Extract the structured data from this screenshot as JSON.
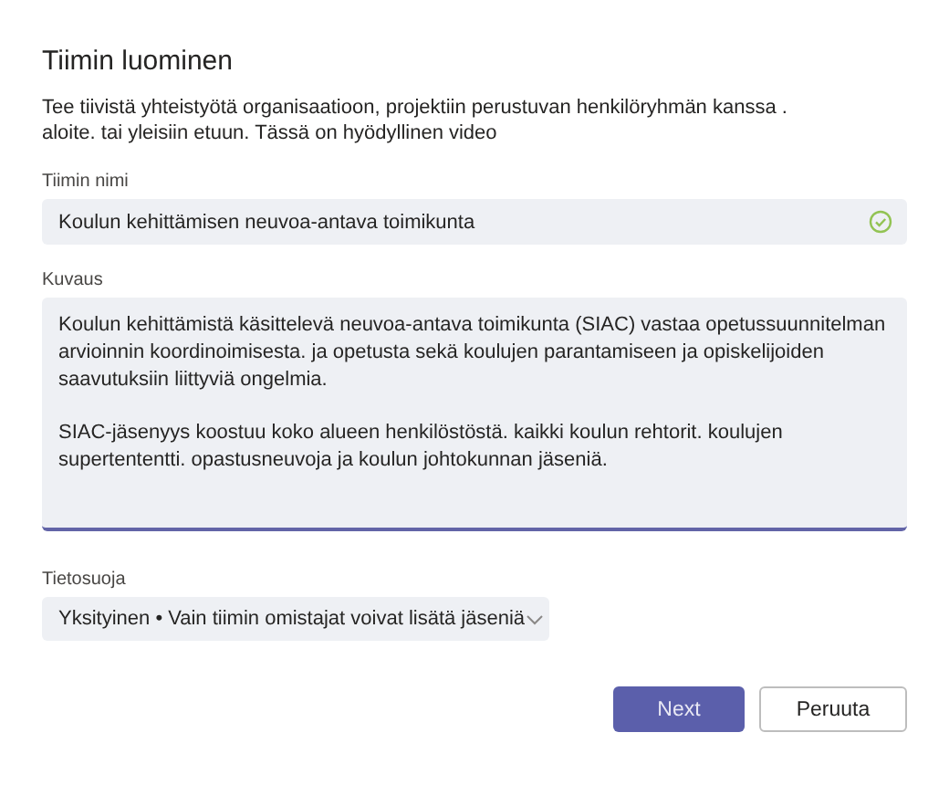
{
  "dialog": {
    "title": "Tiimin luominen",
    "intro": [
      "Tee tiivistä yhteistyötä organisaatioon, projektiin perustuvan henkilöryhmän kanssa .",
      "aloite. tai yleisiin etuun. Tässä on hyödyllinen video"
    ]
  },
  "name_field": {
    "label": "Tiimin nimi",
    "value": "Koulun kehittämisen neuvoa-antava toimikunta",
    "valid": true
  },
  "description_field": {
    "label": "Kuvaus",
    "paragraphs": [
      "Koulun kehittämistä käsittelevä neuvoa-antava toimikunta (SIAC) vastaa opetussuunnitelman arvioinnin koordinoimisesta. ja opetusta sekä koulujen parantamiseen ja opiskelijoiden saavutuksiin liittyviä ongelmia.",
      "SIAC-jäsenyys koostuu koko alueen henkilöstöstä. kaikki koulun rehtorit. koulujen supertententti. opastusneuvoja ja koulun johtokunnan jäseniä."
    ]
  },
  "privacy_field": {
    "label": "Tietosuoja",
    "value": "Yksityinen • Vain tiimin omistajat voivat lisätä jäseniä"
  },
  "buttons": [
    {
      "label": "Next",
      "kind": "primary"
    },
    {
      "label": "Peruuta",
      "kind": "secondary"
    }
  ]
}
